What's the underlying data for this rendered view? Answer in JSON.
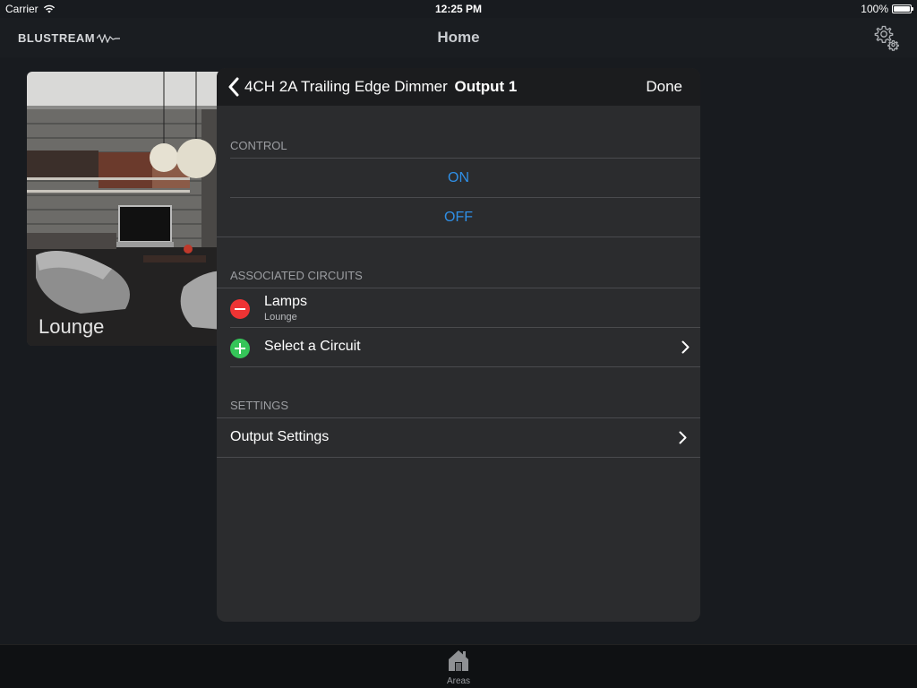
{
  "status_bar": {
    "carrier": "Carrier",
    "time": "12:25 PM",
    "battery": "100%",
    "battery_level": 1.0
  },
  "nav_bar": {
    "logo_text": "BLUSTREAM",
    "title": "Home",
    "settings_icon": "gear-icon"
  },
  "area_card": {
    "label": "Lounge"
  },
  "modal": {
    "back_title": "4CH 2A Trailing Edge Dimmer",
    "title_bold": "Output 1",
    "done_label": "Done",
    "control": {
      "header": "CONTROL",
      "on_label": "ON",
      "off_label": "OFF"
    },
    "associated_circuits": {
      "header": "ASSOCIATED CIRCUITS",
      "items": [
        {
          "title": "Lamps",
          "subtitle": "Lounge",
          "action_icon": "remove-icon"
        }
      ],
      "add_label": "Select a Circuit"
    },
    "settings": {
      "header": "SETTINGS",
      "output_settings_label": "Output Settings"
    }
  },
  "tab_bar": {
    "items": [
      {
        "label": "Areas",
        "icon": "home-icon"
      }
    ]
  },
  "colors": {
    "accent": "#2f8fe6",
    "remove": "#ee3434",
    "add": "#35c559"
  }
}
